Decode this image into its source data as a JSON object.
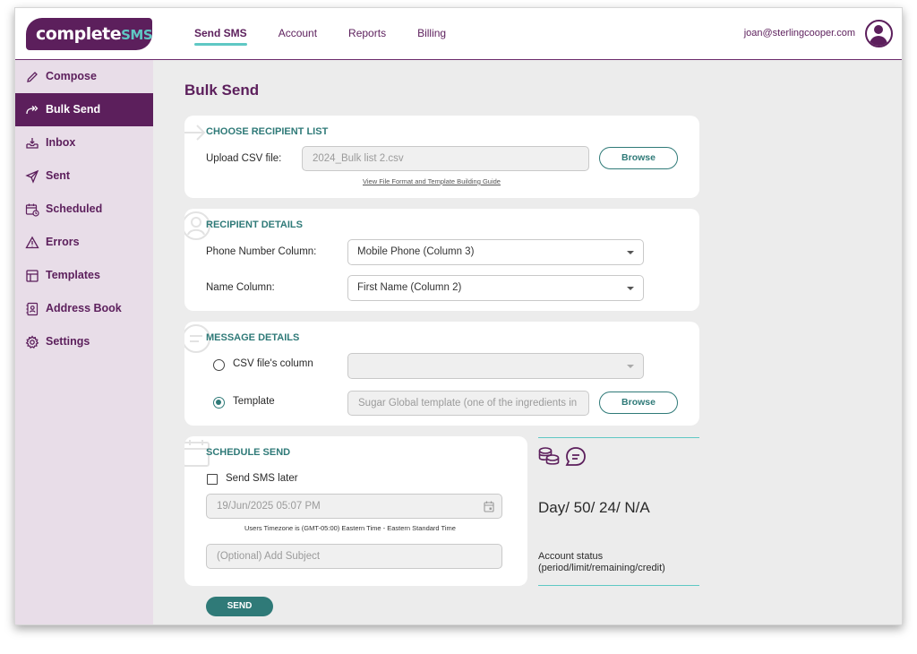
{
  "brand": {
    "name_main": "complete",
    "name_accent": "SMS"
  },
  "topnav": [
    {
      "label": "Send SMS",
      "active": true
    },
    {
      "label": "Account",
      "active": false
    },
    {
      "label": "Reports",
      "active": false
    },
    {
      "label": "Billing",
      "active": false
    }
  ],
  "user": {
    "email": "joan@sterlingcooper.com",
    "avatar_icon": "user-circle-icon"
  },
  "sidebar": {
    "items": [
      {
        "label": "Compose",
        "icon": "pencil-icon",
        "active": false
      },
      {
        "label": "Bulk Send",
        "icon": "forward-arrow-icon",
        "active": true
      },
      {
        "label": "Inbox",
        "icon": "inbox-icon",
        "active": false
      },
      {
        "label": "Sent",
        "icon": "paper-plane-icon",
        "active": false
      },
      {
        "label": "Scheduled",
        "icon": "calendar-clock-icon",
        "active": false
      },
      {
        "label": "Errors",
        "icon": "warning-icon",
        "active": false
      },
      {
        "label": "Templates",
        "icon": "layout-icon",
        "active": false
      },
      {
        "label": "Address Book",
        "icon": "contacts-icon",
        "active": false
      },
      {
        "label": "Settings",
        "icon": "gear-icon",
        "active": false
      }
    ]
  },
  "page": {
    "title": "Bulk Send"
  },
  "recipient_list": {
    "title": "CHOOSE RECIPIENT LIST",
    "upload_label": "Upload CSV file:",
    "file_value": "2024_Bulk list 2.csv",
    "browse_label": "Browse",
    "guide_link": "View File Format and Template Building Guide"
  },
  "recipient_details": {
    "title": "RECIPIENT DETAILS",
    "phone_label": "Phone Number Column:",
    "phone_value": "Mobile Phone (Column 3)",
    "name_label": "Name Column:",
    "name_value": "First Name (Column 2)"
  },
  "message_details": {
    "title": "MESSAGE DETAILS",
    "csv_option_label": "CSV file's column",
    "csv_option_checked": false,
    "csv_column_value": "",
    "template_option_label": "Template",
    "template_option_checked": true,
    "template_value": "Sugar Global template (one of the ingredients in",
    "browse_label": "Browse"
  },
  "schedule": {
    "title": "SCHEDULE SEND",
    "later_label": "Send SMS later",
    "later_checked": false,
    "datetime_value": "19/Jun/2025 05:07 PM",
    "timezone_note": "Users Timezone is (GMT-05:00) Eastern Time - Eastern Standard Time",
    "subject_placeholder": "(Optional) Add Subject"
  },
  "account_status": {
    "value": "Day/ 50/ 24/ N/A",
    "label": "Account status (period/limit/remaining/credit)",
    "icons": [
      "coins-icon",
      "message-icon"
    ]
  },
  "send_button": "SEND",
  "colors": {
    "brand_purple": "#5c1f5c",
    "accent_teal": "#2f7a78",
    "accent_light": "#5fc8c4",
    "sidebar_bg": "#e8dde8"
  }
}
